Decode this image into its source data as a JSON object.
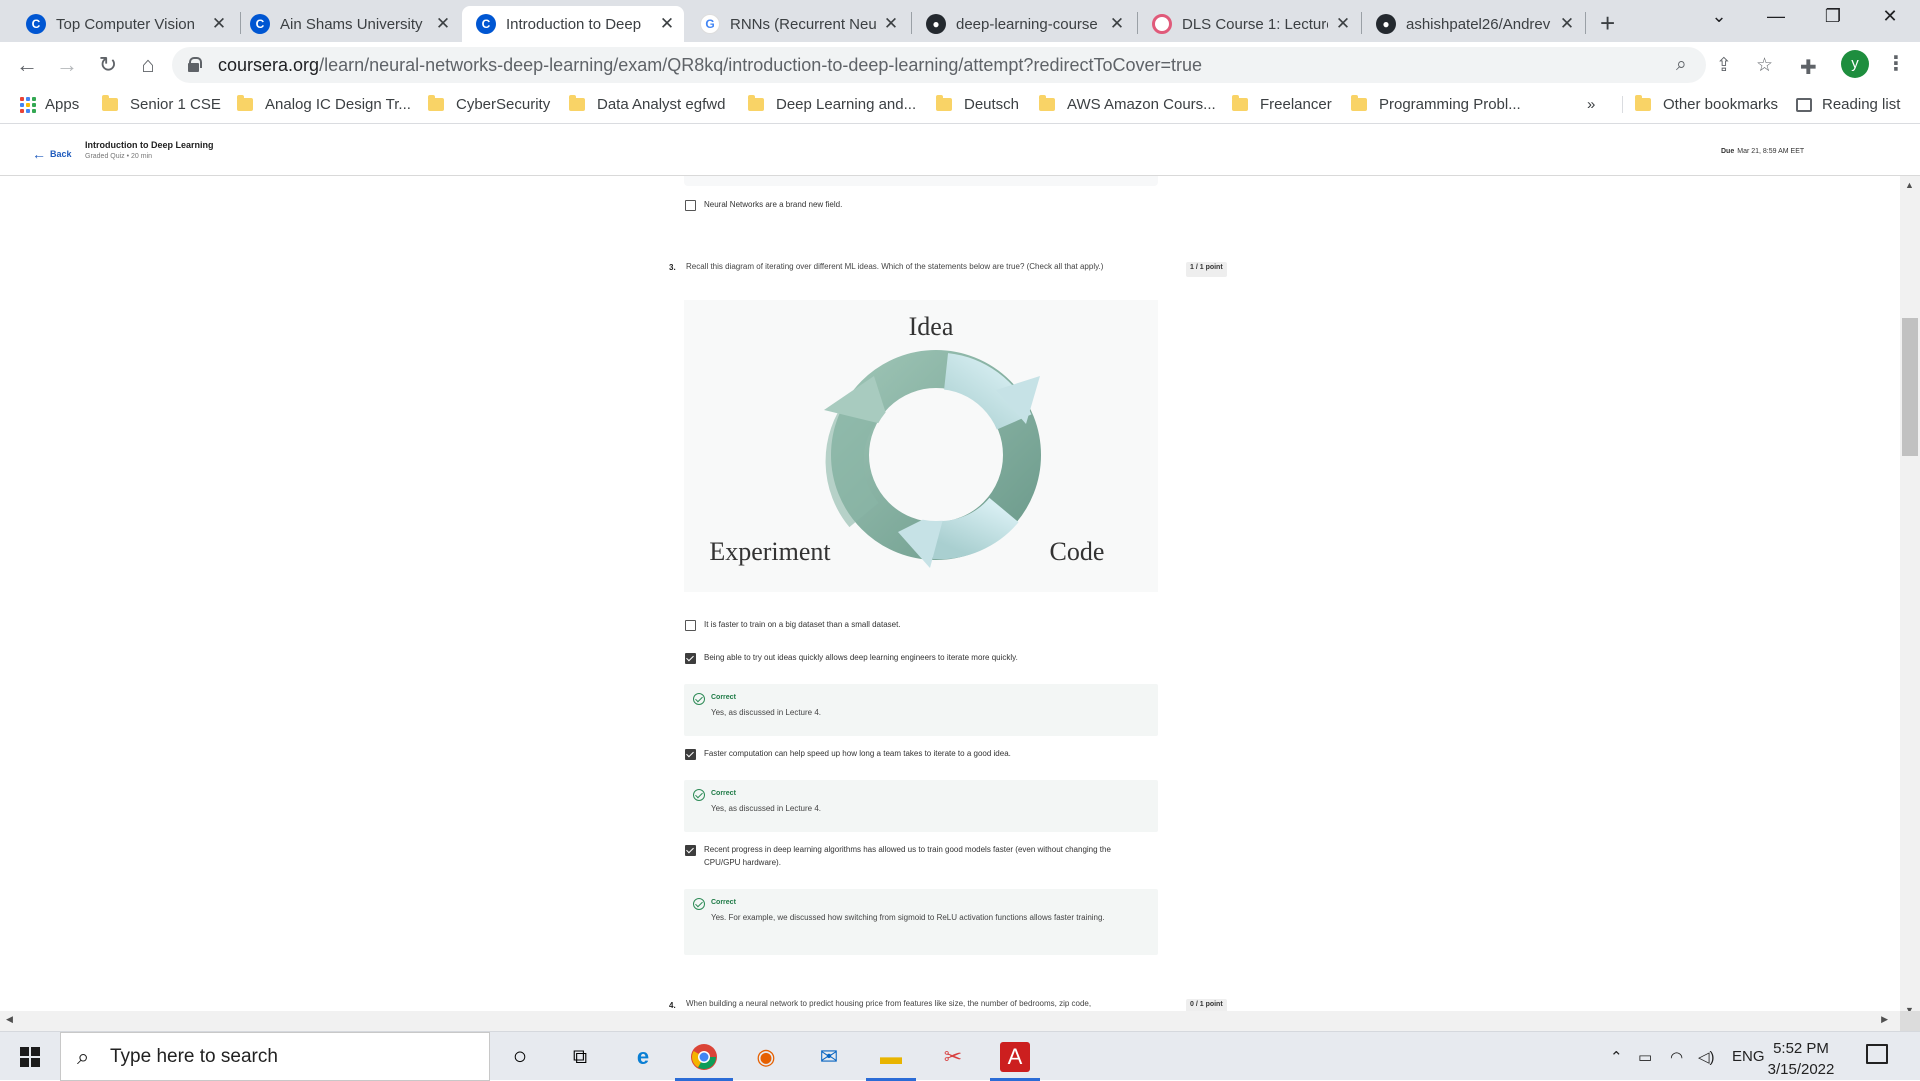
{
  "browser": {
    "tabs": [
      {
        "label": "Top Computer Vision",
        "favicon": "coursera-icon",
        "active": false
      },
      {
        "label": "Ain Shams University",
        "favicon": "coursera-icon",
        "active": false
      },
      {
        "label": "Introduction to Deep",
        "favicon": "coursera-icon",
        "active": true
      },
      {
        "label": "RNNs (Recurrent Neu",
        "favicon": "google-icon",
        "active": false
      },
      {
        "label": "deep-learning-course",
        "favicon": "github-icon",
        "active": false
      },
      {
        "label": "DLS Course 1: Lecture",
        "favicon": "dls-icon",
        "active": false
      },
      {
        "label": "ashishpatel26/Andrev",
        "favicon": "github-icon",
        "active": false
      }
    ],
    "url_host": "coursera.org",
    "url_path": "/learn/neural-networks-deep-learning/exam/QR8kq/introduction-to-deep-learning/attempt?redirectToCover=true",
    "profile_initial": "y",
    "bookmarks": [
      "Senior 1 CSE",
      "Analog IC Design Tr...",
      "CyberSecurity",
      "Data Analyst egfwd",
      "Deep Learning and...",
      "Deutsch",
      "AWS Amazon Cours...",
      "Freelancer",
      "Programming Probl..."
    ],
    "apps_label": "Apps",
    "overflow_label": "»",
    "other_bookmarks": "Other bookmarks",
    "reading_list": "Reading list"
  },
  "quiz_header": {
    "back_label": "Back",
    "title": "Introduction to Deep Learning",
    "subtitle": "Graded Quiz • 20 min",
    "due_label": "Due",
    "due_date": "Mar 21, 8:59 AM EET"
  },
  "quiz": {
    "prev_option": "Neural Networks are a brand new field.",
    "q3": {
      "number": "3.",
      "text": "Recall this diagram of iterating over different ML ideas. Which of the statements below are true? (Check all that apply.)",
      "points": "1 / 1 point",
      "diagram": {
        "idea": "Idea",
        "experiment": "Experiment",
        "code": "Code"
      },
      "options": [
        {
          "text": "It is faster to train on a big dataset than a small dataset.",
          "checked": false
        },
        {
          "text": "Being able to try out ideas quickly allows deep learning engineers to iterate more quickly.",
          "checked": true,
          "feedback": {
            "title": "Correct",
            "text": "Yes, as discussed in Lecture 4."
          }
        },
        {
          "text": "Faster computation can help speed up how long a team takes to iterate to a good idea.",
          "checked": true,
          "feedback": {
            "title": "Correct",
            "text": "Yes, as discussed in Lecture 4."
          }
        },
        {
          "text": "Recent progress in deep learning algorithms has allowed us to train good models faster (even without changing the CPU/GPU hardware).",
          "checked": true,
          "feedback": {
            "title": "Correct",
            "text": "Yes. For example, we discussed how switching from sigmoid to ReLU activation functions allows faster training."
          }
        }
      ]
    },
    "q4": {
      "number": "4.",
      "text": "When building a neural network to predict housing price from features like size, the number of bedrooms, zip code,",
      "points": "0 / 1 point"
    }
  },
  "taskbar": {
    "search_placeholder": "Type here to search",
    "language": "ENG",
    "time": "5:52 PM",
    "date": "3/15/2022"
  },
  "colors": {
    "coursera_blue": "#0056d2",
    "correct_green": "#1e7a46",
    "cycle_dark": "#7fa99a",
    "cycle_light": "#cfe6ea"
  }
}
